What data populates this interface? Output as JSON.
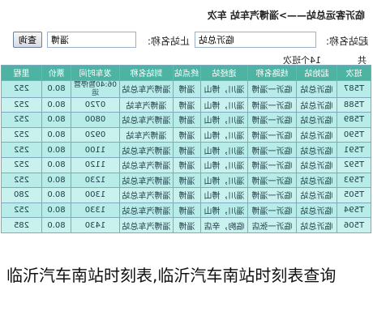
{
  "header": {
    "title": "临沂客运总站——>淄博汽车站 车次"
  },
  "search": {
    "from_label": "起站名称:",
    "from_value": "临沂总站",
    "to_label": "止站名称:",
    "to_value": "淄博",
    "query_button": "查询"
  },
  "summary": {
    "prefix": "共",
    "count": "14个班次"
  },
  "table": {
    "columns": [
      "班次",
      "起始站",
      "线路名称",
      "途经站",
      "终点站",
      "到站名称",
      "发车时间",
      "票价",
      "里程"
    ],
    "rows": [
      [
        "T587",
        "临沂总站",
        "临沂一淄博",
        "淄川，博山",
        "淄博",
        "淄博汽车总站",
        "06:40暂停营运",
        "80.0",
        "252"
      ],
      [
        "T588",
        "临沂总站",
        "临沂一淄博",
        "淄川，博山",
        "淄博",
        "淄博汽车站",
        "0720",
        "80.0",
        "252"
      ],
      [
        "T589",
        "临沂总站",
        "临沂一淄博",
        "淄川，博山",
        "淄博",
        "淄博汽车总站",
        "0800",
        "80.0",
        "252"
      ],
      [
        "T590",
        "临沂总站",
        "临沂一淄博",
        "淄川，博山",
        "淄博",
        "淄博汽车站",
        "0920",
        "80.0",
        "252"
      ],
      [
        "T591",
        "临沂总站",
        "临沂一淄博",
        "淄川，博山",
        "淄博",
        "淄博汽车总站",
        "1100",
        "80.0",
        "252"
      ],
      [
        "T592",
        "临沂总站",
        "临沂一淄博",
        "淄川，博山",
        "淄博",
        "淄博汽车总站",
        "1120",
        "80.0",
        "252"
      ],
      [
        "T593",
        "临沂总站",
        "临沂一淄博",
        "淄川，博山",
        "淄博",
        "淄博汽车总站",
        "1230",
        "80.0",
        "252"
      ],
      [
        "T505",
        "临沂总站",
        "临沂一淄博",
        "淄川，博山",
        "淄博",
        "淄博汽车总站",
        "1300",
        "80.0",
        "280"
      ],
      [
        "T594",
        "临沂总站",
        "临沂一淄博",
        "淄川，博山",
        "淄博",
        "淄博汽车总站",
        "1330",
        "80.0",
        "252"
      ],
      [
        "T506",
        "临沂总站",
        "临沂一张店",
        "临朐，辛店",
        "淄博",
        "淄博汽车总站",
        "1430",
        "80.0",
        "285"
      ]
    ]
  },
  "caption": {
    "text": "临沂汽车南站时刻表,临沂汽车南站时刻表查询"
  }
}
